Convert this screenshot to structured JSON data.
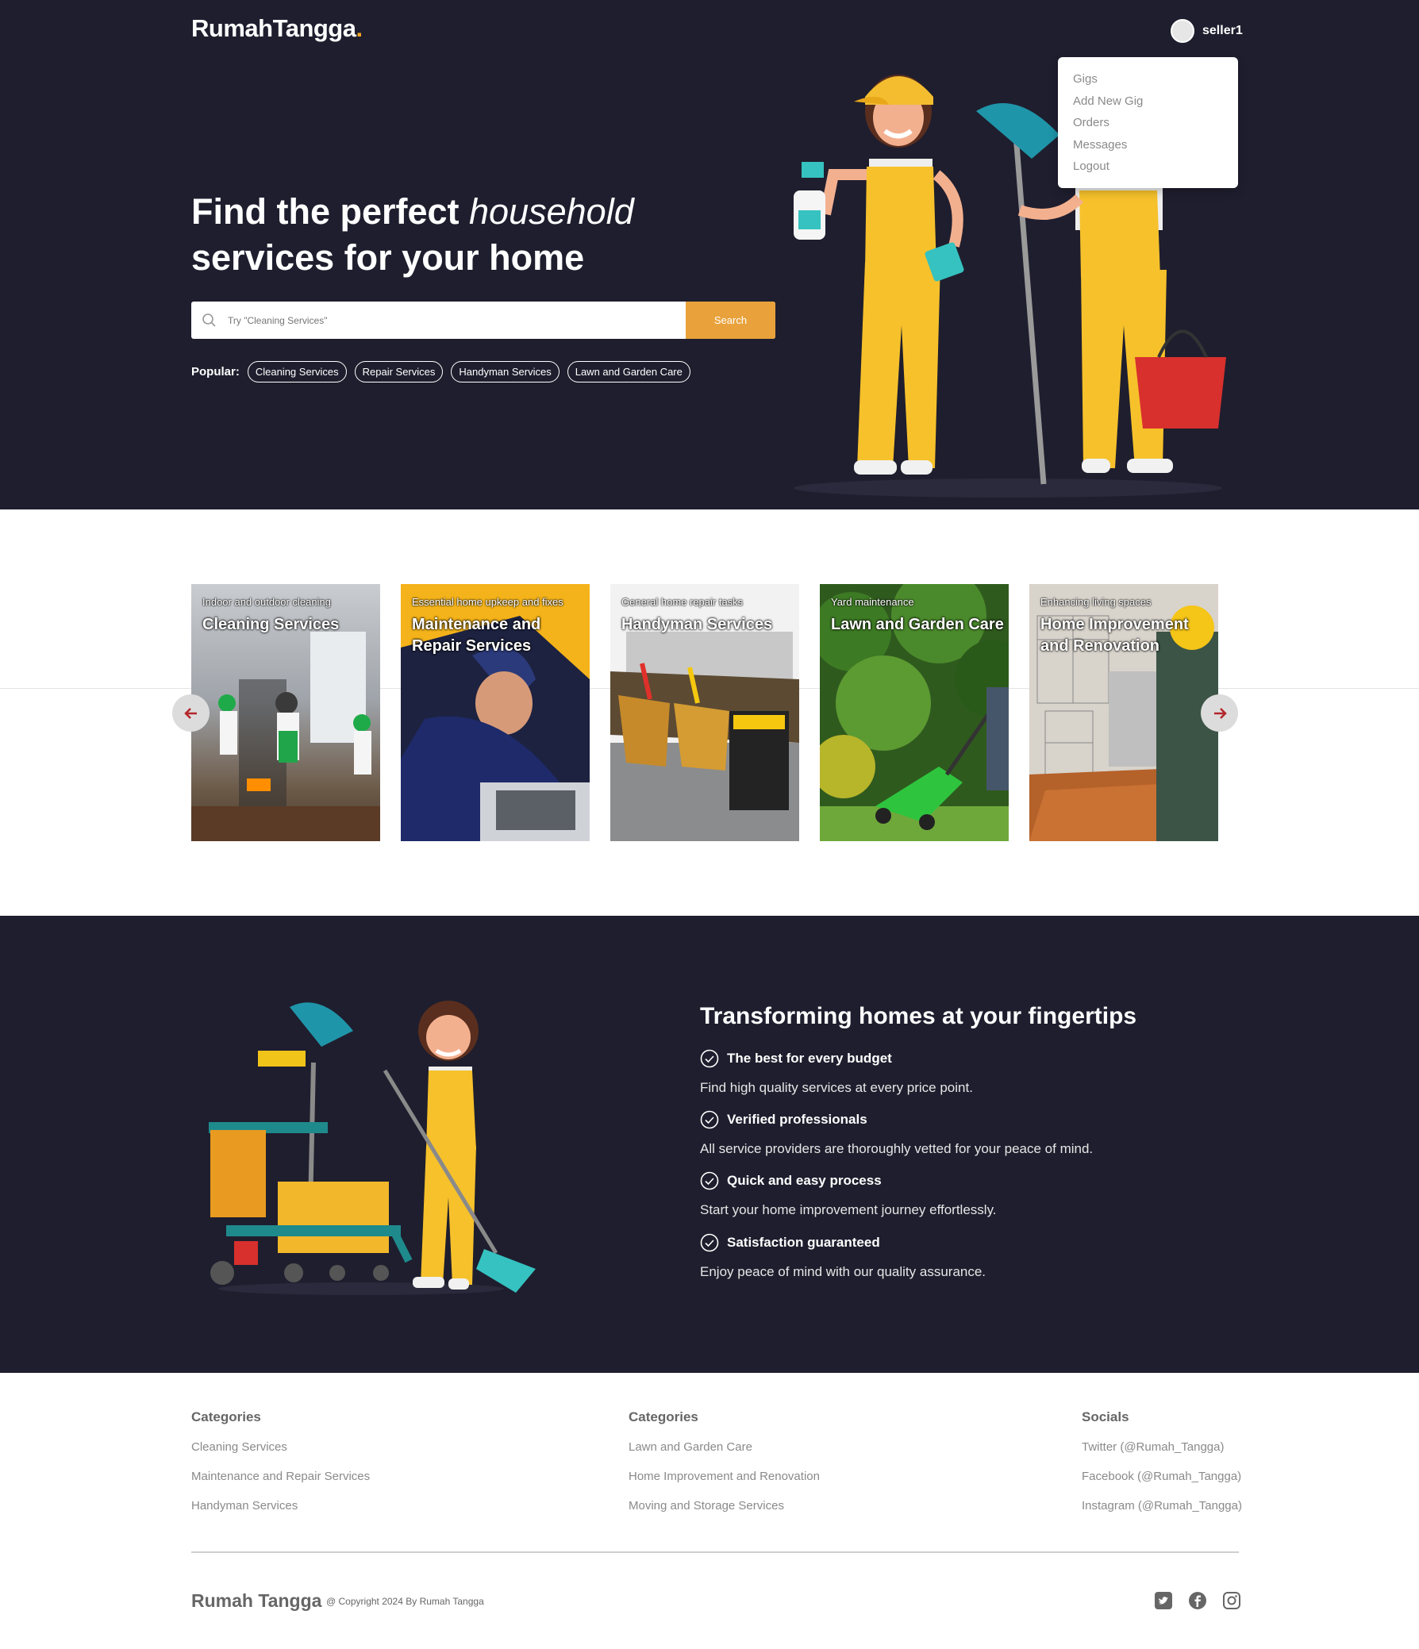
{
  "brand": {
    "name": "RumahTangga",
    "dot": "."
  },
  "user": {
    "name": "seller1"
  },
  "menu": {
    "items": [
      "Gigs",
      "Add New Gig",
      "Orders",
      "Messages",
      "Logout"
    ]
  },
  "hero": {
    "title_part1": "Find the perfect ",
    "title_italic": "household",
    "title_part2": "services for your home",
    "search_placeholder": "Try \"Cleaning Services\"",
    "search_button": "Search",
    "popular_label": "Popular:",
    "popular_tags": [
      "Cleaning Services",
      "Repair Services",
      "Handyman Services",
      "Lawn and Garden Care"
    ]
  },
  "carousel": {
    "cards": [
      {
        "subtitle": "Indoor and outdoor cleaning",
        "title": "Cleaning Services"
      },
      {
        "subtitle": "Essential home upkeep and fixes",
        "title": "Maintenance and Repair Services"
      },
      {
        "subtitle": "General home repair tasks",
        "title": "Handyman Services"
      },
      {
        "subtitle": "Yard maintenance",
        "title": "Lawn and Garden Care"
      },
      {
        "subtitle": "Enhancing living spaces",
        "title": "Home Improvement and Renovation"
      }
    ]
  },
  "features": {
    "title": "Transforming homes at your fingertips",
    "items": [
      {
        "title": "The best for every budget",
        "desc": "Find high quality services at every price point."
      },
      {
        "title": "Verified professionals",
        "desc": "All service providers are thoroughly vetted for your peace of mind."
      },
      {
        "title": "Quick and easy process",
        "desc": "Start your home improvement journey effortlessly."
      },
      {
        "title": "Satisfaction guaranteed",
        "desc": "Enjoy peace of mind with our quality assurance."
      }
    ]
  },
  "footer": {
    "col1": {
      "title": "Categories",
      "links": [
        "Cleaning Services",
        "Maintenance and Repair Services",
        "Handyman Services"
      ]
    },
    "col2": {
      "title": "Categories",
      "links": [
        "Lawn and Garden Care",
        "Home Improvement and Renovation",
        "Moving and Storage Services"
      ]
    },
    "col3": {
      "title": "Socials",
      "links": [
        "Twitter (@Rumah_Tangga)",
        "Facebook (@Rumah_Tangga)",
        "Instagram (@Rumah_Tangga)"
      ]
    },
    "brand": "Rumah Tangga",
    "copyright": "@ Copyright 2024 By Rumah Tangga",
    "social_icons": [
      "twitter-icon",
      "facebook-icon",
      "instagram-icon"
    ]
  },
  "colors": {
    "dark_bg": "#1f1e2e",
    "accent": "#e9a23b",
    "arrow": "#b3262a"
  }
}
